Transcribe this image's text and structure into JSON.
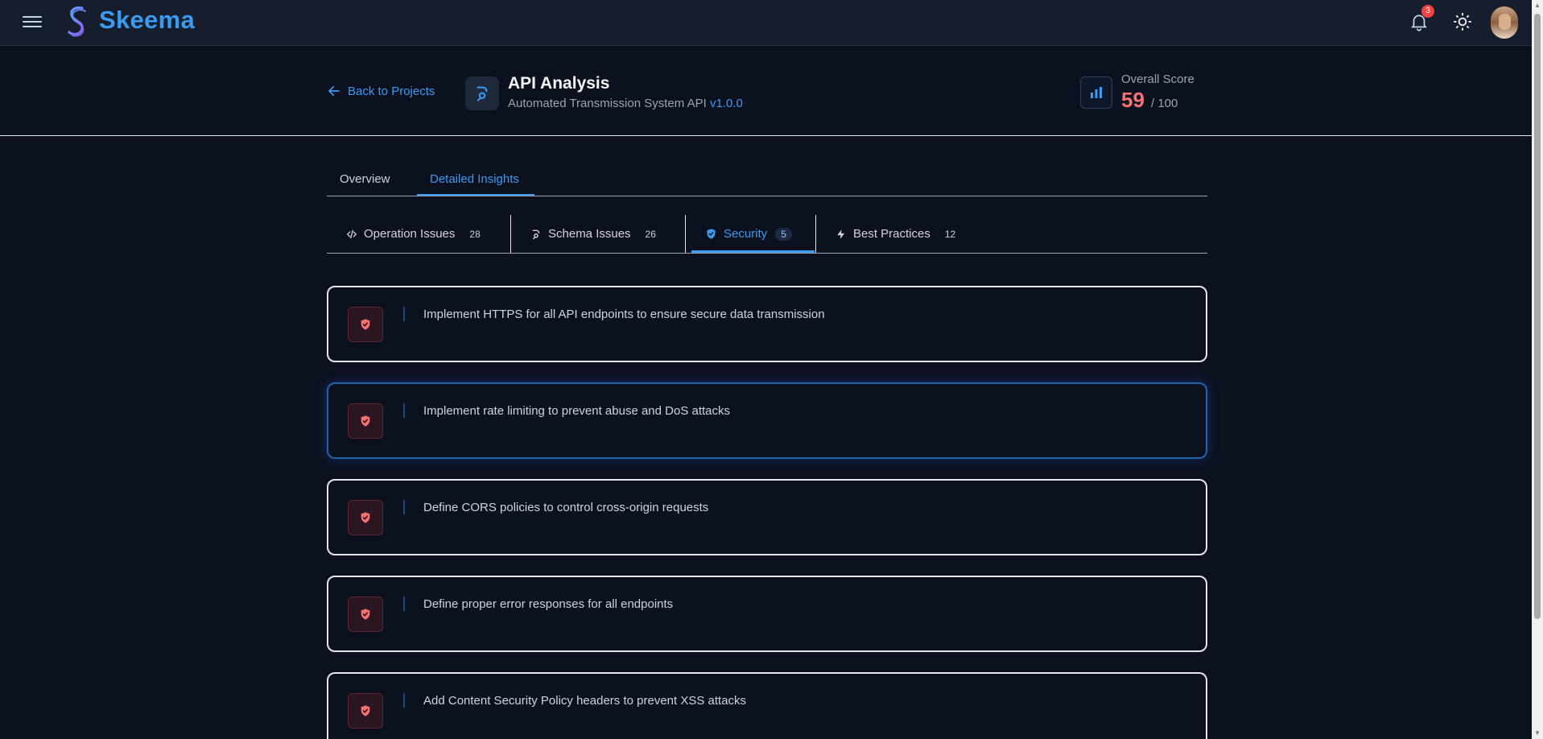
{
  "app": {
    "name": "Skeema"
  },
  "topbar": {
    "notification_count": "3"
  },
  "header": {
    "back_label": "Back to Projects",
    "title": "API Analysis",
    "subtitle": "Automated Transmission System API",
    "version": "v1.0.0",
    "score_label": "Overall Score",
    "score_value": "59",
    "score_max": "/ 100"
  },
  "main_tabs": [
    {
      "label": "Overview",
      "active": false
    },
    {
      "label": "Detailed Insights",
      "active": true
    }
  ],
  "sub_tabs": [
    {
      "label": "Operation Issues",
      "count": "28",
      "icon": "code-icon",
      "active": false
    },
    {
      "label": "Schema Issues",
      "count": "26",
      "icon": "schema-icon",
      "active": false
    },
    {
      "label": "Security",
      "count": "5",
      "icon": "shield-check-icon",
      "active": true
    },
    {
      "label": "Best Practices",
      "count": "12",
      "icon": "bolt-icon",
      "active": false
    }
  ],
  "security_issues": [
    {
      "text": "Implement HTTPS for all API endpoints to ensure secure data transmission"
    },
    {
      "text": "Implement rate limiting to prevent abuse and DoS attacks"
    },
    {
      "text": "Define CORS policies to control cross-origin requests"
    },
    {
      "text": "Define proper error responses for all endpoints"
    },
    {
      "text": "Add Content Security Policy headers to prevent XSS attacks"
    }
  ],
  "colors": {
    "accent": "#3b9bf0",
    "score": "#f87171",
    "background": "#0c1120",
    "badge": "#ef4444"
  }
}
